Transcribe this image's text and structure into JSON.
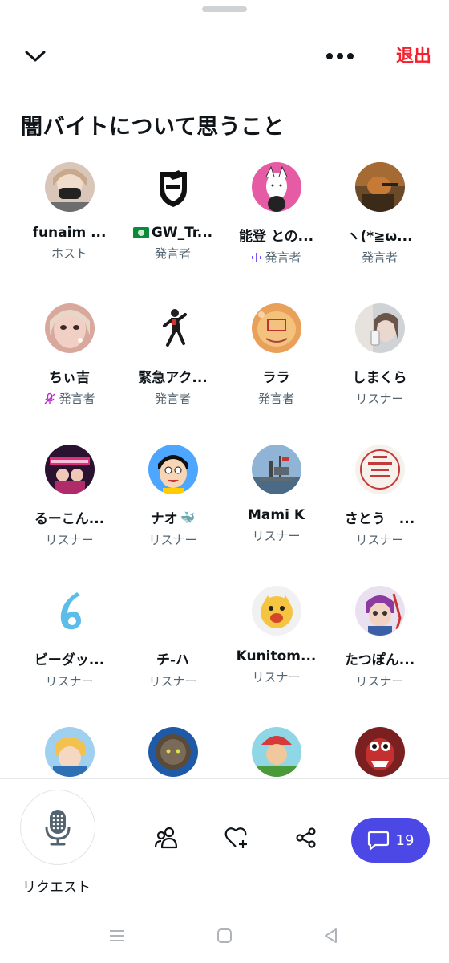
{
  "header": {
    "exit_label": "退出"
  },
  "space": {
    "title": "闇バイトについて思うこと"
  },
  "participants": [
    {
      "name": "funaim ...",
      "role": "ホスト"
    },
    {
      "name": "GW_Tr...",
      "role": "発言者",
      "flag": true
    },
    {
      "name": "能登 との...",
      "role": "発言者",
      "speaking": true
    },
    {
      "name": "ヽ(*≧ω...",
      "role": "発言者"
    },
    {
      "name": "ちぃ吉",
      "role": "発言者",
      "muted": true
    },
    {
      "name": "緊急アク...",
      "role": "発言者"
    },
    {
      "name": "ララ",
      "role": "発言者"
    },
    {
      "name": "しまくら",
      "role": "リスナー"
    },
    {
      "name": "るーこん...",
      "role": "リスナー"
    },
    {
      "name": "ナオ",
      "role": "リスナー",
      "emoji": "🐳"
    },
    {
      "name": "Mami K",
      "role": "リスナー"
    },
    {
      "name": "さとう　...",
      "role": "リスナー"
    },
    {
      "name": "ビーダッ...",
      "role": "リスナー"
    },
    {
      "name": "チ-ハ",
      "role": "リスナー"
    },
    {
      "name": "Kunitom...",
      "role": "リスナー"
    },
    {
      "name": "たつぽん...",
      "role": "リスナー"
    }
  ],
  "bottom_bar": {
    "request_label": "リクエスト",
    "chat_count": "19"
  },
  "colors": {
    "accent": "#4c48e6",
    "exit": "#f4212e",
    "muted": "#c026d3"
  }
}
